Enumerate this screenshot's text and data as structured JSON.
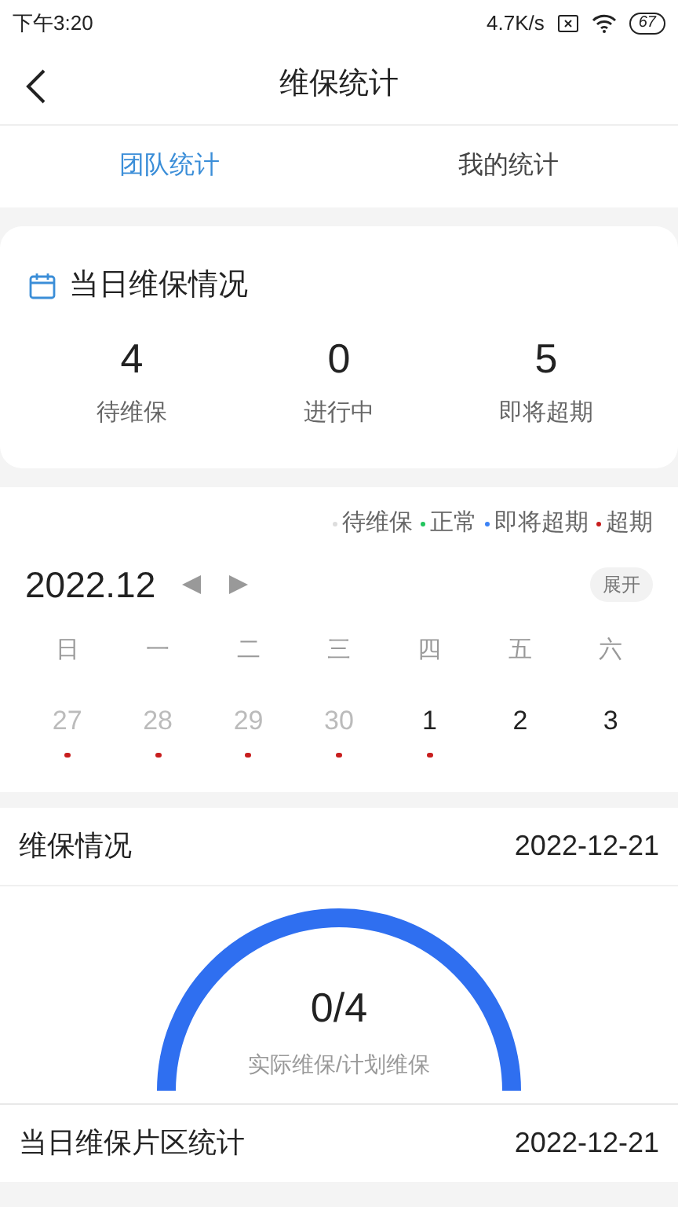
{
  "status_bar": {
    "time": "下午3:20",
    "speed": "4.7K/s",
    "battery": "67"
  },
  "header": {
    "title": "维保统计"
  },
  "tabs": [
    {
      "label": "团队统计",
      "selected": true
    },
    {
      "label": "我的统计",
      "selected": false
    }
  ],
  "today_card": {
    "title": "当日维保情况",
    "stats": [
      {
        "value": "4",
        "label": "待维保"
      },
      {
        "value": "0",
        "label": "进行中"
      },
      {
        "value": "5",
        "label": "即将超期"
      }
    ]
  },
  "calendar": {
    "legend": [
      {
        "label": "待维保",
        "color": "#dddddd"
      },
      {
        "label": "正常",
        "color": "#22c55e"
      },
      {
        "label": "即将超期",
        "color": "#3b82f6"
      },
      {
        "label": "超期",
        "color": "#c81e1e"
      }
    ],
    "month": "2022.12",
    "expand": "展开",
    "weekdays": [
      "日",
      "一",
      "二",
      "三",
      "四",
      "五",
      "六"
    ],
    "days": [
      {
        "label": "27",
        "other_month": true,
        "color": "#c81e1e"
      },
      {
        "label": "28",
        "other_month": true,
        "color": "#c81e1e"
      },
      {
        "label": "29",
        "other_month": true,
        "color": "#c81e1e"
      },
      {
        "label": "30",
        "other_month": true,
        "color": "#c81e1e"
      },
      {
        "label": "1",
        "other_month": false,
        "color": "#c81e1e"
      },
      {
        "label": "2",
        "other_month": false
      },
      {
        "label": "3",
        "other_month": false
      }
    ]
  },
  "maintenance": {
    "title": "维保情况",
    "date": "2022-12-21",
    "ratio": "0/4",
    "caption": "实际维保/计划维保"
  },
  "area_stats": {
    "title": "当日维保片区统计",
    "date": "2022-12-21"
  }
}
